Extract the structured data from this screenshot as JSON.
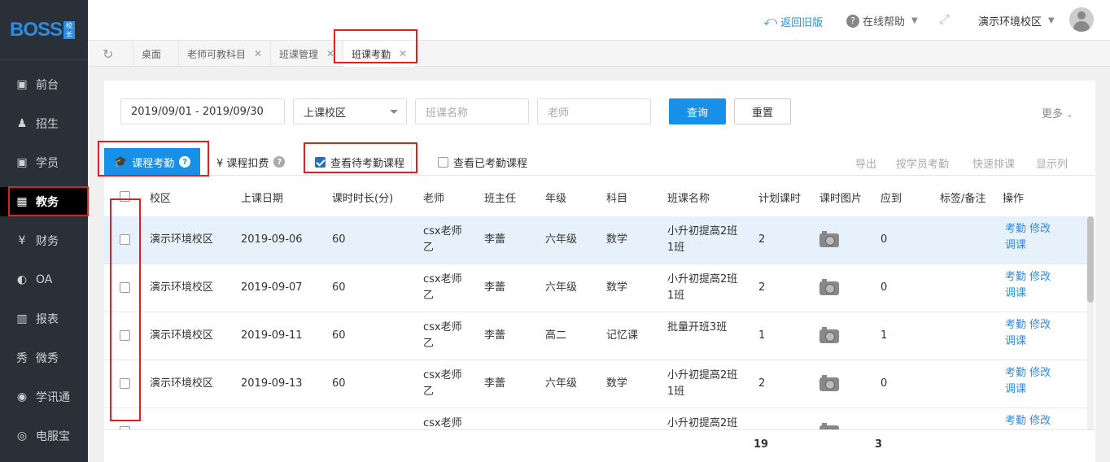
{
  "sidebar": {
    "logo": "BOSS",
    "logo_badge": "校长",
    "items": [
      {
        "label": "前台",
        "icon": "calendar-icon",
        "glyph": "▣"
      },
      {
        "label": "招生",
        "icon": "person-add-icon",
        "glyph": "♟"
      },
      {
        "label": "学员",
        "icon": "student-card-icon",
        "glyph": "▣"
      },
      {
        "label": "教务",
        "icon": "academic-affairs-icon",
        "glyph": "▦"
      },
      {
        "label": "财务",
        "icon": "yen-icon",
        "glyph": "¥"
      },
      {
        "label": "OA",
        "icon": "oa-icon",
        "glyph": "◐"
      },
      {
        "label": "报表",
        "icon": "bar-chart-icon",
        "glyph": "▥"
      },
      {
        "label": "微秀",
        "icon": "weixiu-icon",
        "glyph": "秀"
      },
      {
        "label": "学讯通",
        "icon": "location-pin-icon",
        "glyph": "◉"
      },
      {
        "label": "电服宝",
        "icon": "phone-service-icon",
        "glyph": "◎"
      }
    ]
  },
  "topbar": {
    "back_old": "返回旧版",
    "help": "在线帮助",
    "campus": "演示环境校区"
  },
  "tabs": [
    {
      "label": "桌面",
      "closable": false
    },
    {
      "label": "老师可教科目",
      "closable": true
    },
    {
      "label": "班课管理",
      "closable": true
    },
    {
      "label": "班课考勤",
      "closable": true
    }
  ],
  "filters": {
    "date_range": "2019/09/01 - 2019/09/30",
    "campus_select": "上课校区",
    "class_name_placeholder": "班课名称",
    "teacher_placeholder": "老师",
    "query": "查询",
    "reset": "重置",
    "more": "更多"
  },
  "toolbar": {
    "tab_attendance": "课程考勤",
    "tab_deduction": "¥ 课程扣费",
    "pending_label": "查看待考勤课程",
    "done_label": "查看已考勤课程",
    "export": "导出",
    "by_student": "按学员考勤",
    "quick_schedule": "快速排课",
    "show_columns": "显示列"
  },
  "table": {
    "headers": [
      "校区",
      "上课日期",
      "课时时长(分)",
      "老师",
      "班主任",
      "年级",
      "科目",
      "班课名称",
      "计划课时",
      "课时图片",
      "应到",
      "标签/备注",
      "操作"
    ],
    "rows": [
      {
        "campus": "演示环境校区",
        "date": "2019-09-06",
        "duration": "60",
        "teacher_1": "csx老师",
        "teacher_2": "乙",
        "head": "李蕾",
        "grade": "六年级",
        "subject": "数学",
        "class_1": "小升初提高2班",
        "class_2": "1班",
        "planned": "2",
        "expected": "0"
      },
      {
        "campus": "演示环境校区",
        "date": "2019-09-07",
        "duration": "60",
        "teacher_1": "csx老师",
        "teacher_2": "乙",
        "head": "李蕾",
        "grade": "六年级",
        "subject": "数学",
        "class_1": "小升初提高2班",
        "class_2": "1班",
        "planned": "2",
        "expected": "0"
      },
      {
        "campus": "演示环境校区",
        "date": "2019-09-11",
        "duration": "60",
        "teacher_1": "csx老师",
        "teacher_2": "乙",
        "head": "李蕾",
        "grade": "高二",
        "subject": "记忆课",
        "class_1": "批量开班3班",
        "class_2": "",
        "planned": "1",
        "expected": "1"
      },
      {
        "campus": "演示环境校区",
        "date": "2019-09-13",
        "duration": "60",
        "teacher_1": "csx老师",
        "teacher_2": "乙",
        "head": "李蕾",
        "grade": "六年级",
        "subject": "数学",
        "class_1": "小升初提高2班",
        "class_2": "1班",
        "planned": "2",
        "expected": "0"
      },
      {
        "campus": "",
        "date": "",
        "duration": "",
        "teacher_1": "csx老师",
        "teacher_2": "",
        "head": "",
        "grade": "",
        "subject": "",
        "class_1": "小升初提高2班",
        "class_2": "",
        "planned": "",
        "expected": ""
      }
    ],
    "action_attendance": "考勤",
    "action_edit": "修改",
    "action_adjust": "调课",
    "totals": {
      "planned": "19",
      "expected": "3"
    }
  },
  "colors": {
    "accent": "#1890e8",
    "link": "#2d8ce0",
    "sidebar": "#2a3038",
    "highlight_box": "#e02020"
  }
}
